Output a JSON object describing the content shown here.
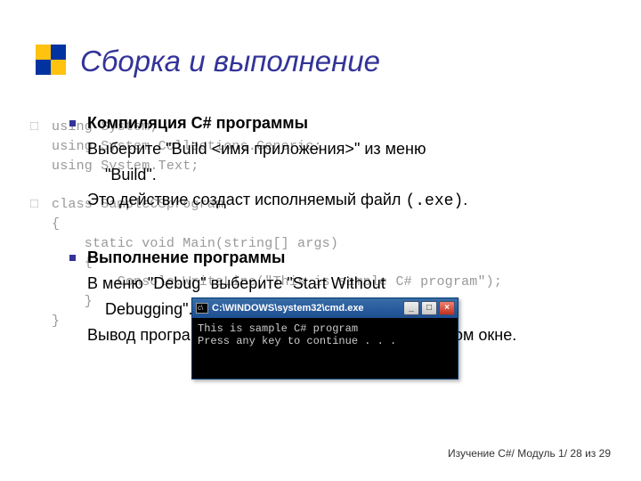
{
  "colors": {
    "accent_yellow": "#ffc20e",
    "accent_blue": "#0033a0",
    "title": "#333399",
    "bullet": "#333399"
  },
  "title": "Сборка и выполнение",
  "section1": {
    "heading": "Компиляция C# программы",
    "line1a": "Выберите \"Build ",
    "line1b": "<имя приложения>",
    "line1c": "\" из меню",
    "line2": "\"Build\".",
    "line3a": "Это действие создаст исполняемый файл ",
    "line3b": "(.exe)",
    "line3c": "."
  },
  "section2": {
    "heading": "Выполнение программы",
    "line1": "В меню \"Debug\" выберите \"Start Without",
    "line2": "Debugging\".",
    "line3": "Вывод программы SampleCS появится в отдельном окне."
  },
  "code_bg": {
    "lines": [
      "using System;",
      "using System.Collections.Generic;",
      "using System.Text;",
      "",
      "class SampleCSprogram",
      "{",
      "    static void Main(string[] args)",
      "    {",
      "        Console.WriteLine(\"This is sample C# program\");",
      "    }",
      "}"
    ],
    "gutters": [
      "□",
      "",
      "",
      "",
      "□",
      "",
      "",
      "",
      "",
      "",
      ""
    ]
  },
  "cmd": {
    "title": "C:\\WINDOWS\\system32\\cmd.exe",
    "buttons": {
      "min": "_",
      "max": "□",
      "close": "×"
    },
    "out1": "This is sample C# program",
    "out2": "Press any key to continue . . ."
  },
  "footer": "Изучение C#/ Модуль 1/ 28 из 29"
}
